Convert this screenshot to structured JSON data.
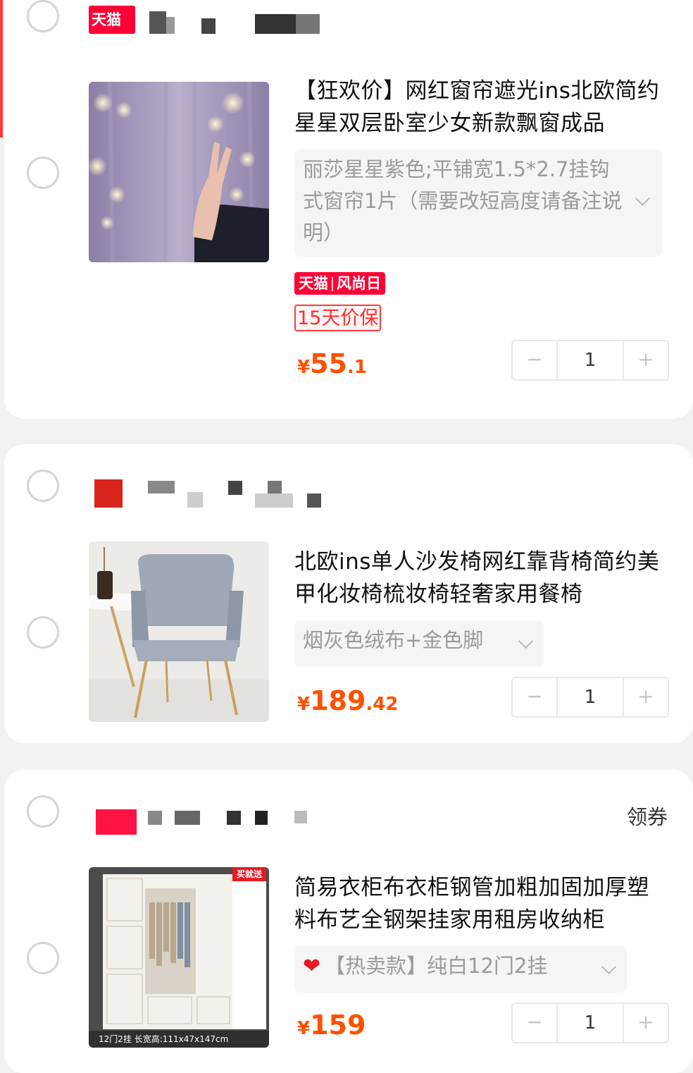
{
  "items": [
    {
      "title": "【狂欢价】网红窗帘遮光ins北欧简约 星星双层卧室少女新款飘窗成品",
      "sku": "丽莎星星紫色;平铺宽1.5*2.7挂钩式窗帘1片（需要改短高度请备注说明）",
      "tag_left": "天猫",
      "tag_right": "风尚日",
      "price_guard": "15天价保",
      "price_symbol": "¥",
      "price_int": "55",
      "price_dec": ".1",
      "quantity": "1"
    },
    {
      "title": "北欧ins单人沙发椅网红靠背椅简约美甲化妆椅梳妆椅轻奢家用餐椅",
      "sku": "烟灰色绒布+金色脚",
      "price_symbol": "¥",
      "price_int": "189",
      "price_dec": ".42",
      "quantity": "1"
    },
    {
      "title": "简易衣柜布衣柜钢管加粗加固加厚塑料布艺全钢架挂家用租房收纳柜",
      "sku": "【热卖款】纯白12门2挂",
      "price_symbol": "¥",
      "price_int": "159",
      "price_dec": "",
      "quantity": "1",
      "thumb_badge": "买就送",
      "thumb_caption": "12门2挂 长宽高:111x47x147cm"
    }
  ],
  "shop1_logo": "天猫",
  "shop3_coupon": "领券",
  "stepper": {
    "minus": "−",
    "plus": "+"
  },
  "colors": {
    "accent": "#ff5000",
    "tmall_red": "#ff0036",
    "card_bg": "#ffffff",
    "page_bg": "#f2f2f2"
  }
}
